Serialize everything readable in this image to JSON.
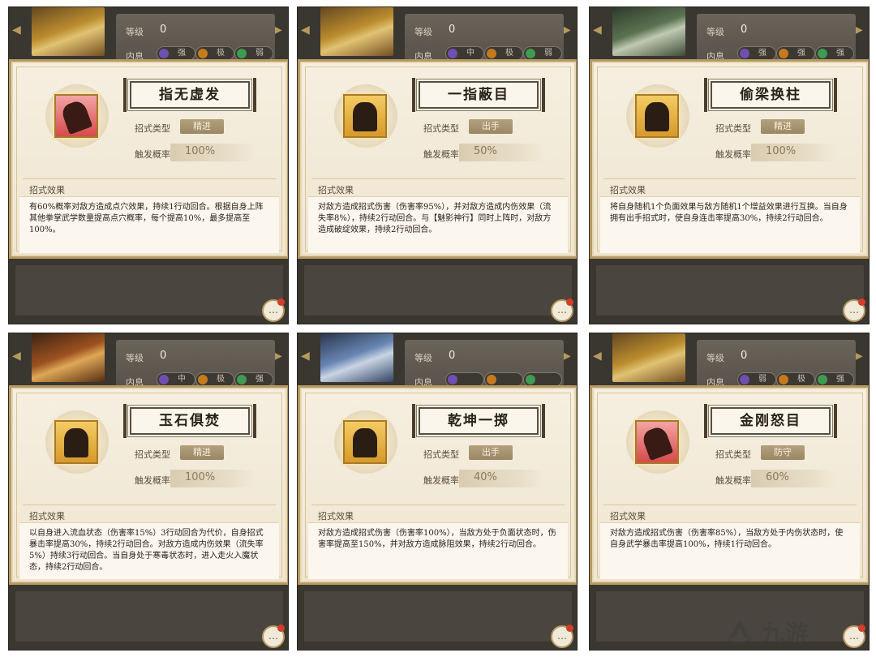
{
  "stats": {
    "level_label": "等级",
    "level_value": "0",
    "inner_label": "内息"
  },
  "labels": {
    "type_label": "招式类型",
    "rate_label": "触发概率",
    "effect_head": "招式效果"
  },
  "cards": [
    {
      "bg_style": "",
      "icon_style": "red",
      "icon": "claw-icon",
      "elements": [
        "强",
        "极",
        "弱"
      ],
      "name": "指无虚发",
      "type": "精进",
      "rate": "100%",
      "effect": "有60%概率对敌方造成点穴效果，持续1行动回合。根据自身上阵其他拳掌武学数量提高点穴概率，每个提高10%，最多提高至100%。"
    },
    {
      "bg_style": "",
      "icon_style": "",
      "icon": "masked-figure-icon",
      "elements": [
        "中",
        "极",
        "弱"
      ],
      "name": "一指蔽目",
      "type": "出手",
      "rate": "50%",
      "effect": "对敌方造成招式伤害（伤害率95%），并对敌方造成内伤效果（流失率8%），持续2行动回合。与【魅影神行】同时上阵时，对敌方造成破绽效果，持续2行动回合。"
    },
    {
      "bg_style": "green",
      "icon_style": "",
      "icon": "twin-figures-icon",
      "elements": [
        "强",
        "强",
        "强"
      ],
      "name": "偷梁换柱",
      "type": "精进",
      "rate": "100%",
      "effect": "将自身随机1个负面效果与敌方随机1个增益效果进行互换。当自身拥有出手招式时，使自身连击率提高30%，持续2行动回合。"
    },
    {
      "bg_style": "fire",
      "icon_style": "",
      "icon": "jade-shards-icon",
      "elements": [
        "中",
        "极",
        "强"
      ],
      "name": "玉石俱焚",
      "type": "精进",
      "rate": "100%",
      "effect": "以自身进入流血状态（伤害率15%）3行动回合为代价，自身招式暴击率提高30%，持续2行动回合。对敌方造成内伤效果（流失率5%）持续3行动回合。当自身处于寒毒状态时，进入走火入魔状态，持续2行动回合。"
    },
    {
      "bg_style": "blue",
      "icon_style": "",
      "icon": "leaping-warrior-icon",
      "elements": [
        "",
        "",
        ""
      ],
      "name": "乾坤一掷",
      "type": "出手",
      "rate": "40%",
      "effect": "对敌方造成招式伤害（伤害率100%），当敌方处于负面状态时，伤害率提高至150%，并对敌方造成脉阻效果，持续2行动回合。"
    },
    {
      "bg_style": "",
      "icon_style": "red",
      "icon": "vajra-face-icon",
      "elements": [
        "弱",
        "极",
        "强"
      ],
      "name": "金刚怒目",
      "type": "防守",
      "rate": "60%",
      "effect": "对敌方造成招式伤害（伤害率85%），当敌方处于内伤状态时，使自身武学暴击率提高100%，持续1行动回合。"
    }
  ],
  "watermark": {
    "text": "九游"
  }
}
